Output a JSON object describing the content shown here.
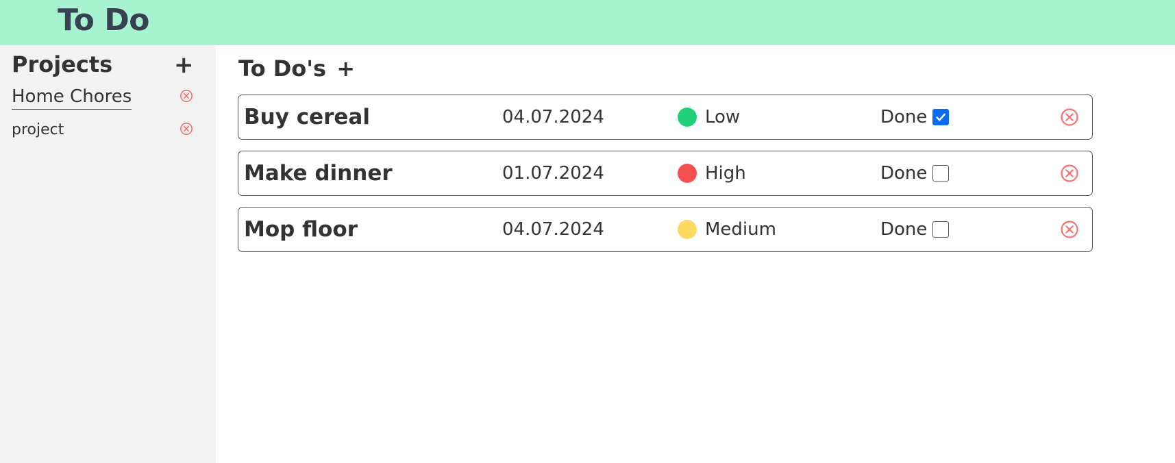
{
  "header": {
    "title": "To Do"
  },
  "sidebar": {
    "heading": "Projects",
    "add_label": "+",
    "projects": [
      {
        "label": "Home Chores",
        "active": true
      },
      {
        "label": "project",
        "active": false
      }
    ]
  },
  "main": {
    "heading": "To Do's",
    "add_label": "+",
    "todos": [
      {
        "title": "Buy cereal",
        "date": "04.07.2024",
        "priority": "Low",
        "priority_color": "#22d07a",
        "done_label": "Done",
        "done": true
      },
      {
        "title": "Make dinner",
        "date": "01.07.2024",
        "priority": "High",
        "priority_color": "#f55050",
        "done_label": "Done",
        "done": false
      },
      {
        "title": "Mop floor",
        "date": "04.07.2024",
        "priority": "Medium",
        "priority_color": "#fcd95f",
        "done_label": "Done",
        "done": false
      }
    ]
  },
  "colors": {
    "header_bg": "#a7f3d0",
    "sidebar_bg": "#f2f2f2",
    "delete_icon": "#f87171",
    "checkbox_checked": "#0b6bf2"
  },
  "icons": {
    "delete": "close-circle-icon",
    "checkmark": "checkmark-icon"
  }
}
